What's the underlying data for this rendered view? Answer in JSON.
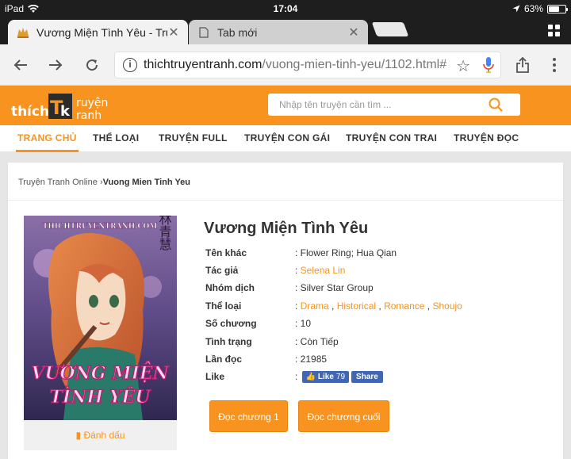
{
  "status_bar": {
    "device": "iPad",
    "time": "17:04",
    "battery": "63%",
    "battery_level": 0.63
  },
  "tabs": [
    {
      "title": "Vương Miện Tình Yêu - Truyện",
      "active": true
    },
    {
      "title": "Tab mới",
      "active": false
    }
  ],
  "omnibox": {
    "host": "thichtruyentranh.com",
    "path": "/vuong-mien-tinh-yeu/1102.html#"
  },
  "site": {
    "logo_text": "thichtruyentranh",
    "search_placeholder": "Nhập tên truyện cần tìm ..."
  },
  "nav": [
    {
      "label": "TRANG CHỦ",
      "active": true
    },
    {
      "label": "THỂ LOẠI"
    },
    {
      "label": "TRUYỆN FULL"
    },
    {
      "label": "TRUYỆN CON GÁI"
    },
    {
      "label": "TRUYỆN CON TRAI"
    },
    {
      "label": "TRUYỆN ĐỌC"
    }
  ],
  "breadcrumb": {
    "root": "Truyện Tranh Online",
    "separator": "›",
    "current": "Vuong Mien Tinh Yeu"
  },
  "cover": {
    "watermark": "THICHTRUYENTRANH.COM",
    "title_line1": "VƯƠNG MIỆN",
    "title_line2": "TÌNH YÊU",
    "kanji": "林青慧"
  },
  "manga": {
    "title": "Vương Miện Tình Yêu",
    "info": {
      "alt_name": {
        "label": "Tên khác",
        "value": ": Flower Ring; Hua Qian"
      },
      "author": {
        "label": "Tác giả",
        "value": "Selena Lin"
      },
      "group": {
        "label": "Nhóm dịch",
        "value": ": Silver Star Group"
      },
      "genre": {
        "label": "Thể loại",
        "values": [
          "Drama",
          "Historical",
          "Romance",
          "Shoujo"
        ]
      },
      "chapters": {
        "label": "Số chương",
        "value": ": 10"
      },
      "status": {
        "label": "Tình trạng",
        "value": ": Còn Tiếp"
      },
      "views": {
        "label": "Lần đọc",
        "value": ": 21985"
      },
      "like": {
        "label": "Like",
        "like_btn": "Like",
        "like_count": "79",
        "share_btn": "Share"
      }
    }
  },
  "actions": {
    "bookmark": "Đánh dấu",
    "read_first": "Đọc chương 1",
    "read_last": "Đọc chương cuối"
  }
}
